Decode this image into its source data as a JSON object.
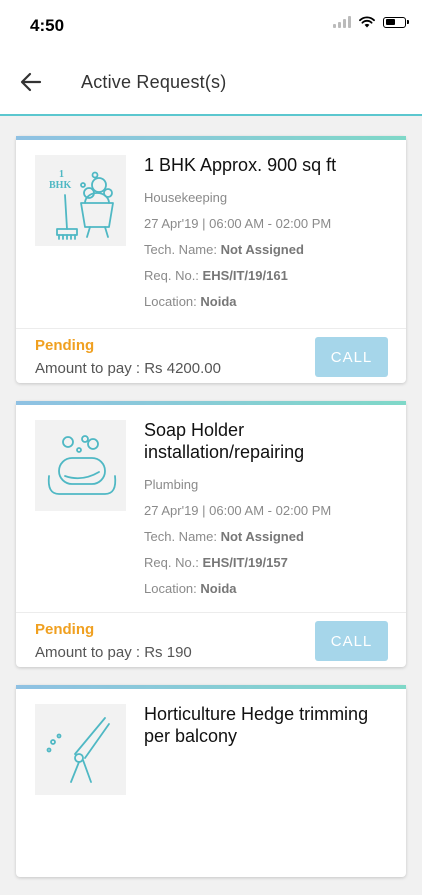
{
  "status_bar": {
    "time": "4:50"
  },
  "header": {
    "title": "Active Request(s)"
  },
  "requests": [
    {
      "title": "1 BHK Approx. 900 sq ft",
      "category": "Housekeeping",
      "schedule": "27 Apr'19 | 06:00 AM - 02:00 PM",
      "tech_label": "Tech. Name: ",
      "tech_value": "Not Assigned",
      "req_label": "Req. No.: ",
      "req_value": "EHS/IT/19/161",
      "location_label": "Location: ",
      "location_value": "Noida",
      "status": "Pending",
      "amount": "Amount to pay : Rs 4200.00",
      "call_label": "CALL",
      "icon": "housekeeping-icon",
      "icon_text": "1\nBHK"
    },
    {
      "title": "Soap Holder installation/repairing",
      "category": "Plumbing",
      "schedule": "27 Apr'19 | 06:00 AM - 02:00 PM",
      "tech_label": "Tech. Name: ",
      "tech_value": "Not Assigned",
      "req_label": "Req. No.: ",
      "req_value": "EHS/IT/19/157",
      "location_label": "Location: ",
      "location_value": "Noida",
      "status": "Pending",
      "amount": "Amount to pay : Rs 190",
      "call_label": "CALL",
      "icon": "soap-holder-icon"
    },
    {
      "title": "Horticulture Hedge trimming per balcony",
      "icon": "hedge-trimmer-icon"
    }
  ],
  "colors": {
    "accent": "#5bc7cf",
    "pending": "#f0a020",
    "call_button": "#a6d6ea",
    "icon_stroke": "#4fb8c4"
  }
}
